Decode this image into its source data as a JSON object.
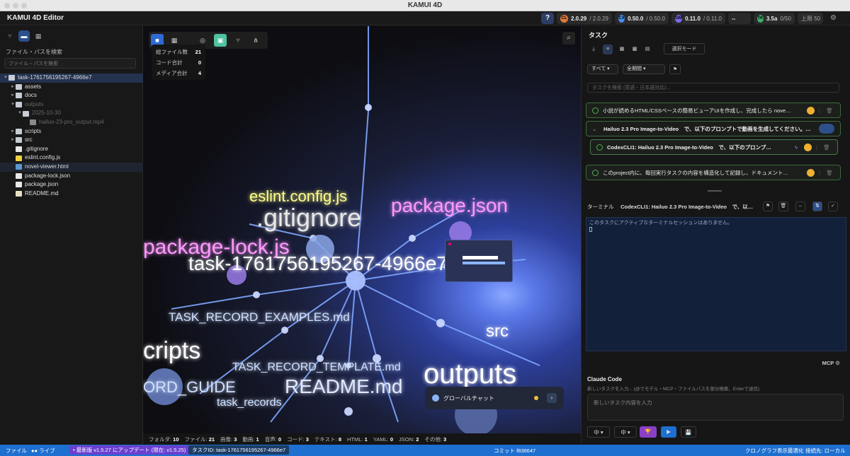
{
  "window": {
    "title": "KAMUI 4D"
  },
  "app": {
    "title": "KAMUI 4D Editor",
    "help": "?"
  },
  "metrics": [
    {
      "abbr": "CL",
      "value": "2.0.29",
      "sub": "/ 2.0.29",
      "color": "#e07b3a"
    },
    {
      "abbr": "CX",
      "value": "0.50.0",
      "sub": "/ 0.50.0",
      "color": "#4a8ef0"
    },
    {
      "abbr": "GM",
      "value": "0.11.0",
      "sub": "/ 0.11.0",
      "color": "#7a6af0"
    },
    {
      "abbr": "",
      "value": "--",
      "sub": "",
      "color": "#555555"
    },
    {
      "abbr": "TK",
      "value": "3.5a",
      "sub": "0/50",
      "color": "#3fae6a"
    },
    {
      "abbr": "",
      "value": "",
      "sub": "上限 50",
      "color": "#2a2a2a"
    }
  ],
  "sidebar": {
    "search_label": "ファイル・パスを検索",
    "search_placeholder": "ファイル・パスを検索",
    "tree": [
      {
        "label": "task-1761756195267-4966e7",
        "indent": 0,
        "caret": "▾",
        "type": "folder",
        "state": "sel"
      },
      {
        "label": "assets",
        "indent": 1,
        "caret": "▸",
        "type": "folder",
        "state": ""
      },
      {
        "label": "docs",
        "indent": 1,
        "caret": "▸",
        "type": "folder",
        "state": ""
      },
      {
        "label": "outputs",
        "indent": 1,
        "caret": "▾",
        "type": "folder",
        "state": "dim"
      },
      {
        "label": "2025-10-30",
        "indent": 2,
        "caret": "▾",
        "type": "folder",
        "state": "dim"
      },
      {
        "label": "hailuo-23-pro_output.mp4",
        "indent": 3,
        "caret": "",
        "type": "video",
        "state": "dim"
      },
      {
        "label": "scripts",
        "indent": 1,
        "caret": "▸",
        "type": "folder",
        "state": ""
      },
      {
        "label": "src",
        "indent": 1,
        "caret": "▸",
        "type": "folder",
        "state": ""
      },
      {
        "label": ".gitignore",
        "indent": 1,
        "caret": "",
        "type": "file",
        "state": ""
      },
      {
        "label": "eslint.config.js",
        "indent": 1,
        "caret": "",
        "type": "js",
        "state": ""
      },
      {
        "label": "novel-viewer.html",
        "indent": 1,
        "caret": "",
        "type": "html",
        "state": "hl"
      },
      {
        "label": "package-lock.json",
        "indent": 1,
        "caret": "",
        "type": "file",
        "state": ""
      },
      {
        "label": "package.json",
        "indent": 1,
        "caret": "",
        "type": "file",
        "state": ""
      },
      {
        "label": "README.md",
        "indent": 1,
        "caret": "",
        "type": "md",
        "state": ""
      }
    ]
  },
  "viewport": {
    "stats": [
      {
        "label": "総ファイル数",
        "value": "21"
      },
      {
        "label": "コード合計",
        "value": "0"
      },
      {
        "label": "メディア合計",
        "value": "4"
      }
    ],
    "labels": [
      {
        "text": "eslint.config.js",
        "color": "#ffff88",
        "size": 22
      },
      {
        "text": ".gitignore",
        "color": "#e8e8e8",
        "size": 36
      },
      {
        "text": "package.json",
        "color": "#ff99ff",
        "size": 28
      },
      {
        "text": "package-lock.js",
        "color": "#ff99ff",
        "size": 30
      },
      {
        "text": "task-1761756195267-4966e7",
        "color": "#ffffff",
        "size": 28
      },
      {
        "text": "TASK_RECORD_EXAMPLES.md",
        "color": "#cfe0ff",
        "size": 17
      },
      {
        "text": "src",
        "color": "#ffffff",
        "size": 24
      },
      {
        "text": "cripts",
        "color": "#ffffff",
        "size": 34
      },
      {
        "text": "TASK_RECORD_TEMPLATE.md",
        "color": "#cfe0ff",
        "size": 16
      },
      {
        "text": "outputs",
        "color": "#ffffff",
        "size": 40
      },
      {
        "text": "ORD_GUIDE",
        "color": "#cfe0ff",
        "size": 22
      },
      {
        "text": "README.md",
        "color": "#e0e8ff",
        "size": 28
      },
      {
        "text": "task_records",
        "color": "#cfe0ff",
        "size": 16
      },
      {
        "text": "novel-viewer.html",
        "color": "#ffffff",
        "size": 7
      }
    ],
    "global_chat": "グローバルチャット"
  },
  "bottom_stats": [
    {
      "label": "フォルダ:",
      "value": "10"
    },
    {
      "label": "ファイル:",
      "value": "21"
    },
    {
      "label": "画像:",
      "value": "3"
    },
    {
      "label": "動画:",
      "value": "1"
    },
    {
      "label": "音声:",
      "value": "0"
    },
    {
      "label": "コード:",
      "value": "3"
    },
    {
      "label": "テキスト:",
      "value": "8"
    },
    {
      "label": "HTML:",
      "value": "1"
    },
    {
      "label": "YAML:",
      "value": "0"
    },
    {
      "label": "JSON:",
      "value": "2"
    },
    {
      "label": "その他:",
      "value": "3"
    }
  ],
  "tasks": {
    "title": "タスク",
    "select_mode": "選択モード",
    "filter_status": "すべて",
    "filter_period": "全期間",
    "search_placeholder": "タスクを検索 (英語・日本語対応)...",
    "items": [
      {
        "text": "小説が読めるHTML/CSSベースの簡易ビューアUIを作成し、完成したら nove…"
      },
      {
        "text": "Hailuo 2.3 Pro Image-to-Video　で、以下のプロンプトで動画を生成してください。…"
      },
      {
        "text": "CodexCLI1: Hailuo 2.3 Pro Image-to-Video　で、以下のプロンプ…"
      },
      {
        "text": "このproject内に、毎回実行タスクの内容を構造化して記録し、ドキュメント…"
      }
    ]
  },
  "terminal": {
    "label": "ターミナル",
    "session": "CodexCLI1: Hailuo 2.3 Pro Image-to-Video　で、以…",
    "message": "このタスクにアクティブなターミナルセッションはありません。"
  },
  "claude": {
    "mcp": "MCP",
    "title": "Claude Code",
    "hint": "新しいタスクを入力... (@でモデル・MCP・ファイルパスを部分検索、Enterで送信)",
    "placeholder": "新しいタスク内容を入力",
    "level1": "中",
    "level2": "中"
  },
  "statusbar": {
    "files": "ファイル",
    "live": "ライブ",
    "update": "最新版 v1.5.27 にアップデート (現在: v1.5.25)",
    "task_id": "タスクID: task-1761756195267-4966e7",
    "commit": "コミット f836647",
    "chrono": "クロノグラフ表示最適化",
    "connection": "接続先: ローカル"
  }
}
